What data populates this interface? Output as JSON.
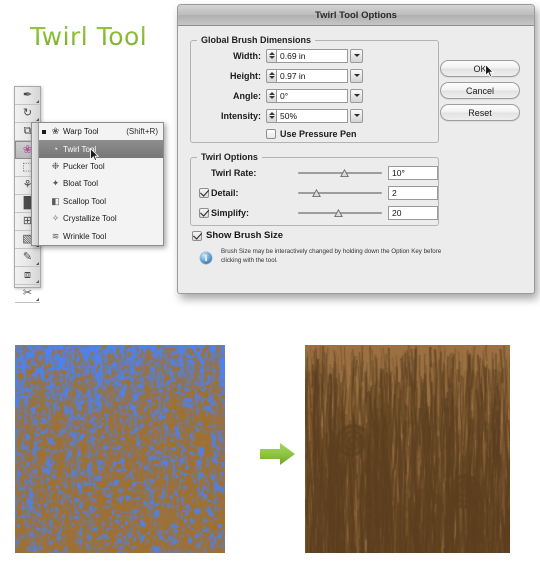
{
  "page": {
    "title": "Twirl Tool"
  },
  "toolbar": {
    "name": "illustrator-tool-panel",
    "tools": [
      {
        "name": "pen-tool",
        "glyph": "✒",
        "selected": false
      },
      {
        "name": "rotate-tool",
        "glyph": "↻",
        "selected": false
      },
      {
        "name": "scale-tool",
        "glyph": "⧉",
        "selected": false
      },
      {
        "name": "warp-tool",
        "glyph": "❀",
        "selected": true
      },
      {
        "name": "free-transform-tool",
        "glyph": "⬚",
        "selected": false
      },
      {
        "name": "symbol-sprayer-tool",
        "glyph": "⚘",
        "selected": false
      },
      {
        "name": "column-graph-tool",
        "glyph": "█",
        "selected": false
      },
      {
        "name": "mesh-tool",
        "glyph": "⊞",
        "selected": false
      },
      {
        "name": "gradient-tool",
        "glyph": "▧",
        "selected": false
      },
      {
        "name": "eyedropper-tool",
        "glyph": "✎",
        "selected": false
      },
      {
        "name": "blend-tool",
        "glyph": "⧈",
        "selected": false
      },
      {
        "name": "slice-tool",
        "glyph": "✂",
        "selected": false
      }
    ]
  },
  "flyout": {
    "name": "warp-tool-flyout",
    "items": [
      {
        "label": "Warp Tool",
        "shortcut": "(Shift+R)",
        "icon": "warp-tool-icon",
        "glyph": "❀",
        "bullet": true,
        "active": false
      },
      {
        "label": "Twirl Tool",
        "shortcut": "",
        "icon": "twirl-tool-icon",
        "glyph": "◔",
        "bullet": false,
        "active": true
      },
      {
        "label": "Pucker Tool",
        "shortcut": "",
        "icon": "pucker-tool-icon",
        "glyph": "❉",
        "bullet": false,
        "active": false
      },
      {
        "label": "Bloat Tool",
        "shortcut": "",
        "icon": "bloat-tool-icon",
        "glyph": "✦",
        "bullet": false,
        "active": false
      },
      {
        "label": "Scallop Tool",
        "shortcut": "",
        "icon": "scallop-tool-icon",
        "glyph": "◧",
        "bullet": false,
        "active": false
      },
      {
        "label": "Crystallize Tool",
        "shortcut": "",
        "icon": "crystallize-tool-icon",
        "glyph": "✧",
        "bullet": false,
        "active": false
      },
      {
        "label": "Wrinkle Tool",
        "shortcut": "",
        "icon": "wrinkle-tool-icon",
        "glyph": "≋",
        "bullet": false,
        "active": false
      }
    ]
  },
  "dialog": {
    "title": "Twirl Tool Options",
    "global_brush": {
      "legend": "Global Brush Dimensions",
      "fields": [
        {
          "label": "Width:",
          "value": "0.69 in"
        },
        {
          "label": "Height:",
          "value": "0.97 in"
        },
        {
          "label": "Angle:",
          "value": "0°"
        },
        {
          "label": "Intensity:",
          "value": "50%"
        }
      ],
      "pressure_pen": {
        "label": "Use Pressure Pen",
        "checked": false
      }
    },
    "twirl_options": {
      "legend": "Twirl Options",
      "rows": [
        {
          "label": "Twirl Rate:",
          "value": "10°",
          "checkbox": false,
          "checked": false,
          "slider_pct": 55
        },
        {
          "label": "Detail:",
          "value": "2",
          "checkbox": true,
          "checked": true,
          "slider_pct": 22
        },
        {
          "label": "Simplify:",
          "value": "20",
          "checkbox": true,
          "checked": true,
          "slider_pct": 48
        }
      ]
    },
    "show_brush_size": {
      "label": "Show Brush Size",
      "checked": true
    },
    "hint": "Brush Size may be interactively changed by holding down the Option Key before clicking with the tool.",
    "buttons": [
      {
        "label": "OK",
        "name": "ok-button",
        "default": true
      },
      {
        "label": "Cancel",
        "name": "cancel-button",
        "default": false
      },
      {
        "label": "Reset",
        "name": "reset-button",
        "default": false
      }
    ]
  },
  "illustration": {
    "before": {
      "name": "texture-before-blue",
      "base_color": "#4f82ea",
      "grain_color": "#a2712e"
    },
    "after": {
      "name": "texture-after-wood",
      "base_color": "#9b7142",
      "grain_color": "#5d4021"
    },
    "arrow": {
      "name": "right-arrow-icon",
      "color": "#8ec640"
    }
  },
  "colors": {
    "title_green_light": "#95c93d",
    "title_green_dark": "#7ba52c",
    "accent_blue": "#4f82ea",
    "wood_brown": "#9b7142",
    "arrow_green": "#8ec640"
  }
}
